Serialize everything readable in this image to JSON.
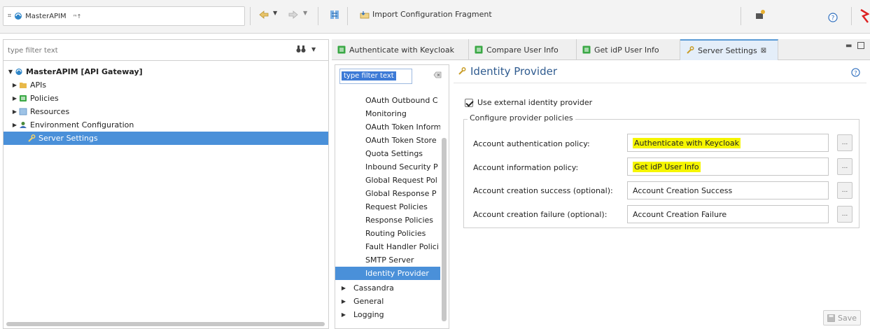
{
  "toolbar": {
    "project_name": "MasterAPIM",
    "import_label": "Import Configuration Fragment"
  },
  "left_panel": {
    "filter_placeholder": "type filter text",
    "tree": [
      {
        "label": "MasterAPIM [API Gateway]",
        "arrow": "▼"
      },
      {
        "label": "APIs",
        "arrow": "▶"
      },
      {
        "label": "Policies",
        "arrow": "▶"
      },
      {
        "label": "Resources",
        "arrow": "▶"
      },
      {
        "label": "Environment Configuration",
        "arrow": "▶"
      },
      {
        "label": "Server Settings",
        "arrow": ""
      }
    ]
  },
  "tabs": [
    {
      "label": "Authenticate with Keycloak"
    },
    {
      "label": "Compare User Info"
    },
    {
      "label": "Get idP User Info"
    },
    {
      "label": "Server Settings",
      "close": "⊠"
    }
  ],
  "nav_panel": {
    "filter_text": "type filter text",
    "items": [
      {
        "label": "OAuth Outbound C"
      },
      {
        "label": "Monitoring"
      },
      {
        "label": "OAuth Token Inform"
      },
      {
        "label": "OAuth Token Store"
      },
      {
        "label": "Quota Settings"
      },
      {
        "label": "Inbound Security P"
      },
      {
        "label": "Global Request Pol"
      },
      {
        "label": "Global Response P"
      },
      {
        "label": "Request Policies"
      },
      {
        "label": "Response Policies"
      },
      {
        "label": "Routing Policies"
      },
      {
        "label": "Fault Handler Polici"
      },
      {
        "label": "SMTP Server"
      },
      {
        "label": "Identity Provider"
      },
      {
        "label": "Cassandra",
        "arrow": "▶"
      },
      {
        "label": "General",
        "arrow": "▶"
      },
      {
        "label": "Logging",
        "arrow": "▶"
      }
    ]
  },
  "content": {
    "title": "Identity Provider",
    "use_external_label": "Use external identity provider",
    "group_label": "Configure provider policies",
    "rows": [
      {
        "label": "Account authentication policy:",
        "value": "Authenticate with Keycloak"
      },
      {
        "label": "Account information policy:",
        "value": "Get idP User Info"
      },
      {
        "label": "Account creation success (optional):",
        "value": "Account Creation Success"
      },
      {
        "label": "Account creation failure (optional):",
        "value": "Account Creation Failure"
      }
    ],
    "dots_label": "...",
    "save_label": "Save"
  }
}
